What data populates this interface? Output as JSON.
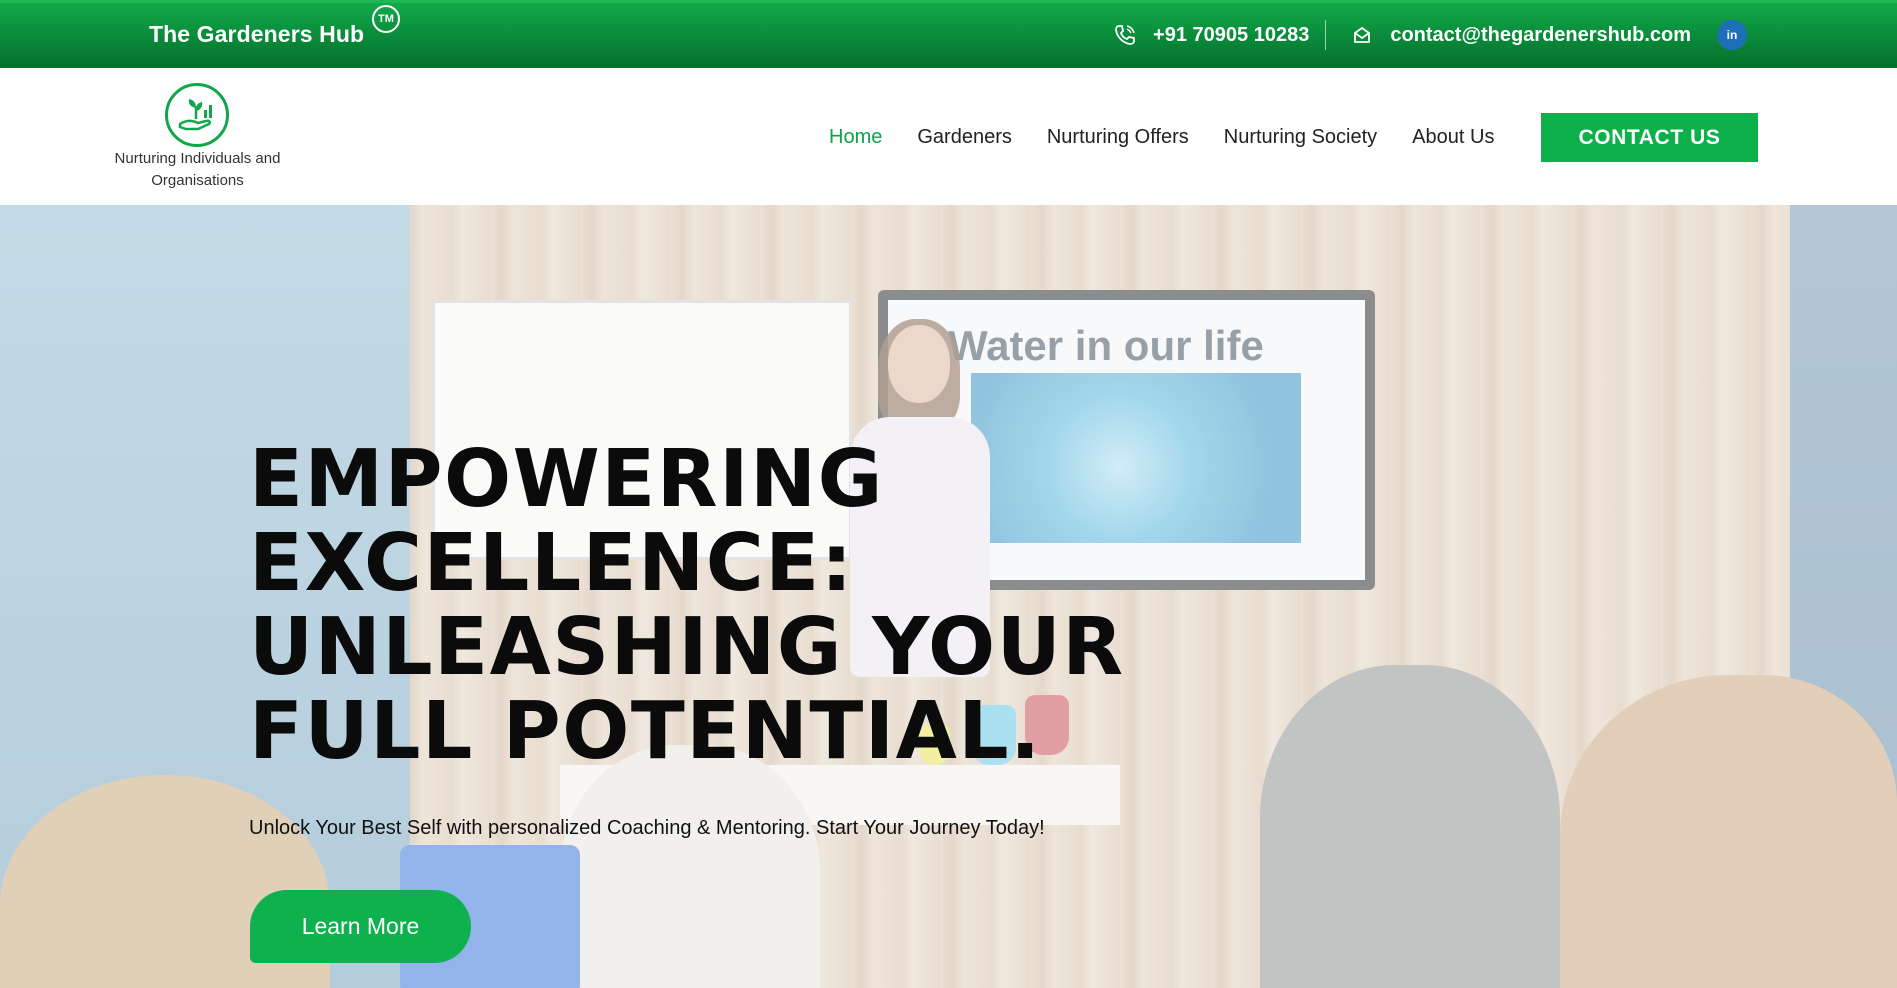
{
  "topbar": {
    "brand": "The Gardeners Hub",
    "trademark": "TM",
    "phone": "+91 70905 10283",
    "email": "contact@thegardenershub.com",
    "linkedin_icon": "linkedin-icon",
    "background_color": "#0a8f3c"
  },
  "header": {
    "tagline_line1": "Nurturing Individuals and",
    "tagline_line2": "Organisations",
    "nav": [
      {
        "label": "Home",
        "active": true
      },
      {
        "label": "Gardeners",
        "active": false
      },
      {
        "label": "Nurturing Offers",
        "active": false
      },
      {
        "label": "Nurturing Society",
        "active": false
      },
      {
        "label": "About Us",
        "active": false
      }
    ],
    "cta_label": "CONTACT US",
    "accent_color": "#0bb04b"
  },
  "hero": {
    "headline_line1": "EMPOWERING",
    "headline_line2": "EXCELLENCE:",
    "headline_line3": "UNLEASHING YOUR",
    "headline_line4": "FULL POTENTIAL.",
    "subtext": "Unlock Your Best Self with personalized Coaching & Mentoring. Start Your Journey Today!",
    "button_label": "Learn More",
    "screen_text": "Water in our life"
  }
}
